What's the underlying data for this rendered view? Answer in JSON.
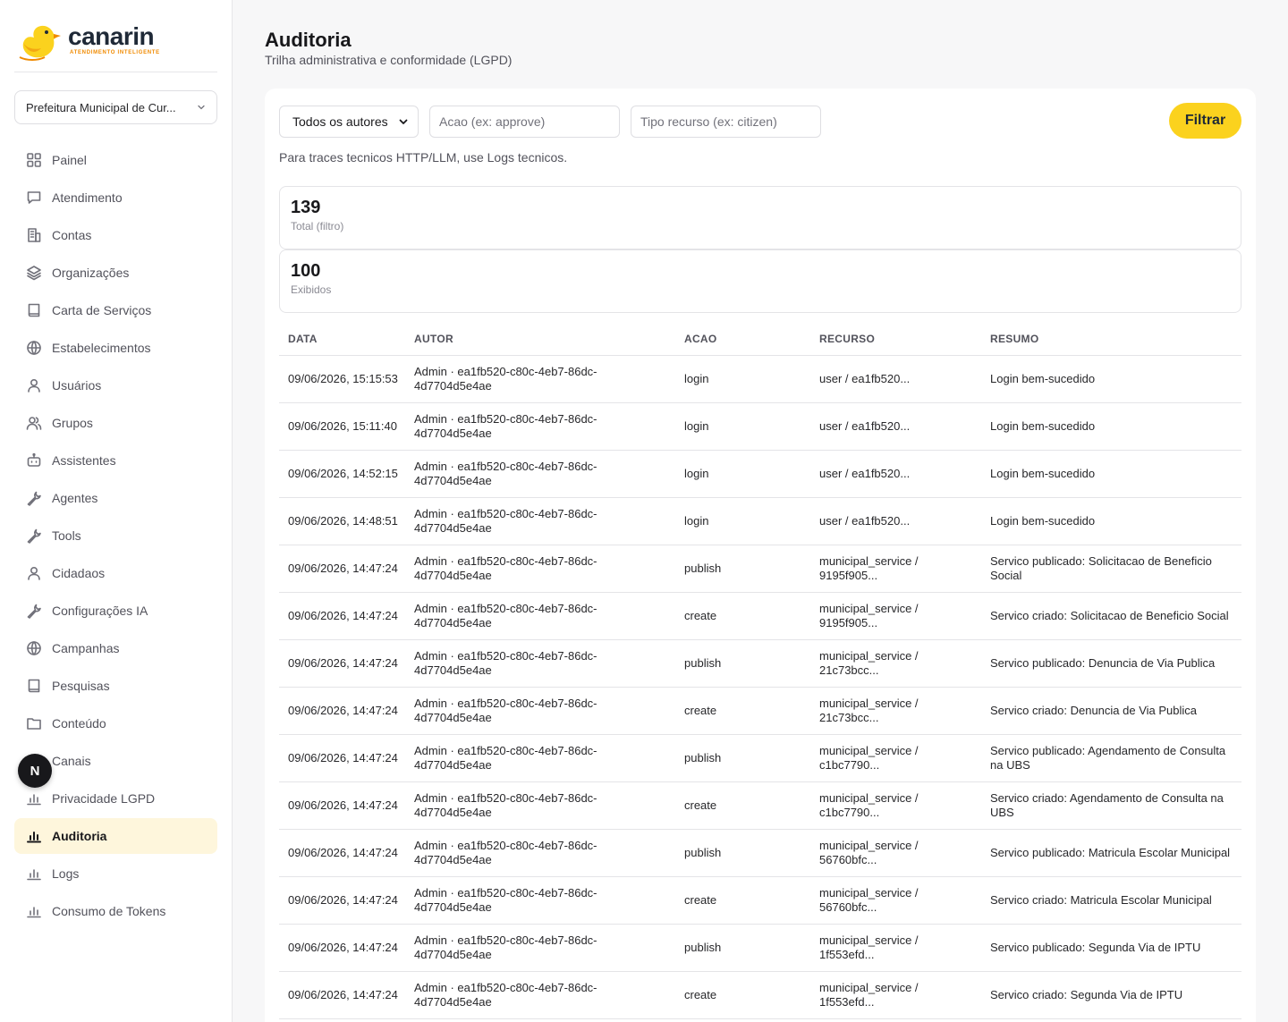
{
  "brand": {
    "name": "canarin",
    "tagline": "ATENDIMENTO INTELIGENTE",
    "accent": "#fbd21e"
  },
  "org_selector": {
    "value": "Prefeitura Municipal de Curitiba",
    "display": "Prefeitura Municipal de Cur..."
  },
  "sidebar": {
    "items": [
      {
        "label": "Painel",
        "icon": "grid-icon"
      },
      {
        "label": "Atendimento",
        "icon": "message-icon"
      },
      {
        "label": "Contas",
        "icon": "building-icon"
      },
      {
        "label": "Organizações",
        "icon": "layers-icon"
      },
      {
        "label": "Carta de Serviços",
        "icon": "book-icon"
      },
      {
        "label": "Estabelecimentos",
        "icon": "globe-icon"
      },
      {
        "label": "Usuários",
        "icon": "user-icon"
      },
      {
        "label": "Grupos",
        "icon": "users-icon"
      },
      {
        "label": "Assistentes",
        "icon": "bot-icon"
      },
      {
        "label": "Agentes",
        "icon": "wrench-icon"
      },
      {
        "label": "Tools",
        "icon": "wrench-icon"
      },
      {
        "label": "Cidadaos",
        "icon": "user-icon"
      },
      {
        "label": "Configurações IA",
        "icon": "wrench-icon"
      },
      {
        "label": "Campanhas",
        "icon": "globe-icon"
      },
      {
        "label": "Pesquisas",
        "icon": "book-icon"
      },
      {
        "label": "Conteúdo",
        "icon": "folder-icon"
      },
      {
        "label": "Canais",
        "icon": "chart-icon"
      },
      {
        "label": "Privacidade LGPD",
        "icon": "chart-icon"
      },
      {
        "label": "Auditoria",
        "icon": "chart-icon",
        "active": true
      },
      {
        "label": "Logs",
        "icon": "chart-icon"
      },
      {
        "label": "Consumo de Tokens",
        "icon": "chart-icon"
      }
    ]
  },
  "floating_badge": "N",
  "page": {
    "title": "Auditoria",
    "subtitle": "Trilha administrativa e conformidade (LGPD)"
  },
  "filters": {
    "authors_value": "Todos os autores",
    "action_placeholder": "Acao (ex: approve)",
    "resource_placeholder": "Tipo recurso (ex: citizen)",
    "submit_label": "Filtrar"
  },
  "hint": "Para traces tecnicos HTTP/LLM, use Logs tecnicos.",
  "stats": [
    {
      "value": "139",
      "caption": "Total (filtro)"
    },
    {
      "value": "100",
      "caption": "Exibidos"
    }
  ],
  "table": {
    "columns": [
      "DATA",
      "AUTOR",
      "ACAO",
      "RECURSO",
      "RESUMO"
    ],
    "rows": [
      {
        "date": "09/06/2026, 15:15:53",
        "author": "Admin · ea1fb520-c80c-4eb7-86dc-4d7704d5e4ae",
        "action": "login",
        "resource": "user / ea1fb520...",
        "summary": "Login bem-sucedido"
      },
      {
        "date": "09/06/2026, 15:11:40",
        "author": "Admin · ea1fb520-c80c-4eb7-86dc-4d7704d5e4ae",
        "action": "login",
        "resource": "user / ea1fb520...",
        "summary": "Login bem-sucedido"
      },
      {
        "date": "09/06/2026, 14:52:15",
        "author": "Admin · ea1fb520-c80c-4eb7-86dc-4d7704d5e4ae",
        "action": "login",
        "resource": "user / ea1fb520...",
        "summary": "Login bem-sucedido"
      },
      {
        "date": "09/06/2026, 14:48:51",
        "author": "Admin · ea1fb520-c80c-4eb7-86dc-4d7704d5e4ae",
        "action": "login",
        "resource": "user / ea1fb520...",
        "summary": "Login bem-sucedido"
      },
      {
        "date": "09/06/2026, 14:47:24",
        "author": "Admin · ea1fb520-c80c-4eb7-86dc-4d7704d5e4ae",
        "action": "publish",
        "resource": "municipal_service / 9195f905...",
        "summary": "Servico publicado: Solicitacao de Beneficio Social"
      },
      {
        "date": "09/06/2026, 14:47:24",
        "author": "Admin · ea1fb520-c80c-4eb7-86dc-4d7704d5e4ae",
        "action": "create",
        "resource": "municipal_service / 9195f905...",
        "summary": "Servico criado: Solicitacao de Beneficio Social"
      },
      {
        "date": "09/06/2026, 14:47:24",
        "author": "Admin · ea1fb520-c80c-4eb7-86dc-4d7704d5e4ae",
        "action": "publish",
        "resource": "municipal_service / 21c73bcc...",
        "summary": "Servico publicado: Denuncia de Via Publica"
      },
      {
        "date": "09/06/2026, 14:47:24",
        "author": "Admin · ea1fb520-c80c-4eb7-86dc-4d7704d5e4ae",
        "action": "create",
        "resource": "municipal_service / 21c73bcc...",
        "summary": "Servico criado: Denuncia de Via Publica"
      },
      {
        "date": "09/06/2026, 14:47:24",
        "author": "Admin · ea1fb520-c80c-4eb7-86dc-4d7704d5e4ae",
        "action": "publish",
        "resource": "municipal_service / c1bc7790...",
        "summary": "Servico publicado: Agendamento de Consulta na UBS"
      },
      {
        "date": "09/06/2026, 14:47:24",
        "author": "Admin · ea1fb520-c80c-4eb7-86dc-4d7704d5e4ae",
        "action": "create",
        "resource": "municipal_service / c1bc7790...",
        "summary": "Servico criado: Agendamento de Consulta na UBS"
      },
      {
        "date": "09/06/2026, 14:47:24",
        "author": "Admin · ea1fb520-c80c-4eb7-86dc-4d7704d5e4ae",
        "action": "publish",
        "resource": "municipal_service / 56760bfc...",
        "summary": "Servico publicado: Matricula Escolar Municipal"
      },
      {
        "date": "09/06/2026, 14:47:24",
        "author": "Admin · ea1fb520-c80c-4eb7-86dc-4d7704d5e4ae",
        "action": "create",
        "resource": "municipal_service / 56760bfc...",
        "summary": "Servico criado: Matricula Escolar Municipal"
      },
      {
        "date": "09/06/2026, 14:47:24",
        "author": "Admin · ea1fb520-c80c-4eb7-86dc-4d7704d5e4ae",
        "action": "publish",
        "resource": "municipal_service / 1f553efd...",
        "summary": "Servico publicado: Segunda Via de IPTU"
      },
      {
        "date": "09/06/2026, 14:47:24",
        "author": "Admin · ea1fb520-c80c-4eb7-86dc-4d7704d5e4ae",
        "action": "create",
        "resource": "municipal_service / 1f553efd...",
        "summary": "Servico criado: Segunda Via de IPTU"
      }
    ]
  }
}
